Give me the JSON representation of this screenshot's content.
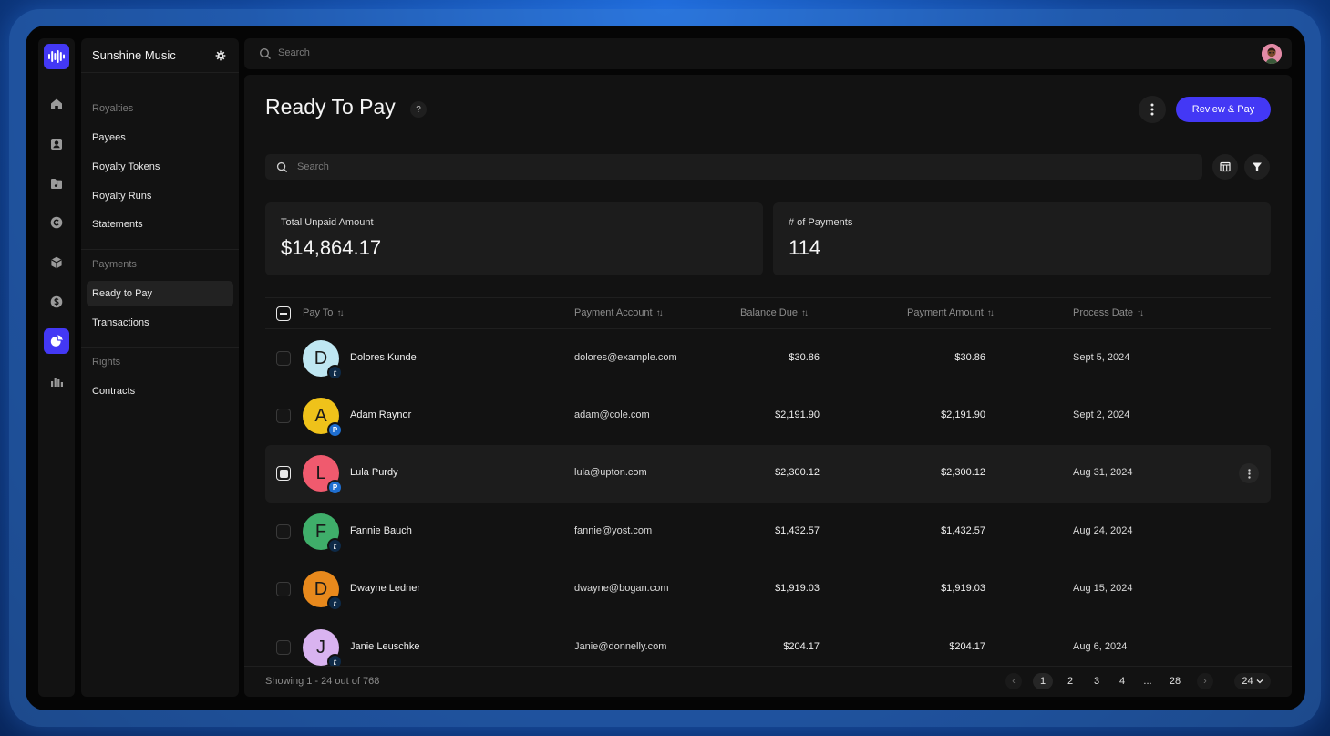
{
  "app": {
    "org_name": "Sunshine Music",
    "search_placeholder": "Search"
  },
  "sidebar": {
    "sections": [
      {
        "label": "Royalties",
        "items": [
          "Payees",
          "Royalty Tokens",
          "Royalty Runs",
          "Statements"
        ]
      },
      {
        "label": "Payments",
        "items": [
          "Ready to Pay",
          "Transactions"
        ]
      },
      {
        "label": "Rights",
        "items": [
          "Contracts"
        ]
      }
    ],
    "active_item": "Ready to Pay"
  },
  "rail": {
    "icons": [
      "home-icon",
      "contacts-icon",
      "music-folder-icon",
      "copyright-icon",
      "box-icon",
      "dollar-icon",
      "payments-icon",
      "analytics-icon"
    ],
    "active_icon": "payments-icon"
  },
  "page": {
    "title": "Ready To Pay",
    "help": "?",
    "primary_action": "Review & Pay",
    "search_placeholder": "Search"
  },
  "stats": [
    {
      "label": "Total Unpaid Amount",
      "value": "$14,864.17"
    },
    {
      "label": "# of Payments",
      "value": "114"
    }
  ],
  "table": {
    "columns": [
      "Pay To",
      "Payment Account",
      "Balance Due",
      "Payment Amount",
      "Process Date"
    ],
    "rows": [
      {
        "initial": "D",
        "avatar_color": "#bfe7f2",
        "method": "tipalti",
        "name": "Dolores Kunde",
        "account": "dolores@example.com",
        "balance": "$30.86",
        "amount": "$30.86",
        "date": "Sept 5, 2024",
        "checked": false
      },
      {
        "initial": "A",
        "avatar_color": "#efc21a",
        "method": "paypal",
        "name": "Adam Raynor",
        "account": "adam@cole.com",
        "balance": "$2,191.90",
        "amount": "$2,191.90",
        "date": "Sept 2, 2024",
        "checked": false
      },
      {
        "initial": "L",
        "avatar_color": "#f05a6e",
        "method": "paypal",
        "name": "Lula Purdy",
        "account": "lula@upton.com",
        "balance": "$2,300.12",
        "amount": "$2,300.12",
        "date": "Aug 31, 2024",
        "checked": true
      },
      {
        "initial": "F",
        "avatar_color": "#3fae6a",
        "method": "tipalti",
        "name": "Fannie Bauch",
        "account": "fannie@yost.com",
        "balance": "$1,432.57",
        "amount": "$1,432.57",
        "date": "Aug 24, 2024",
        "checked": false
      },
      {
        "initial": "D",
        "avatar_color": "#e8891c",
        "method": "tipalti",
        "name": "Dwayne Ledner",
        "account": "dwayne@bogan.com",
        "balance": "$1,919.03",
        "amount": "$1,919.03",
        "date": "Aug 15, 2024",
        "checked": false
      },
      {
        "initial": "J",
        "avatar_color": "#d9b3f0",
        "method": "tipalti",
        "name": "Janie Leuschke",
        "account": "Janie@donnelly.com",
        "balance": "$204.17",
        "amount": "$204.17",
        "date": "Aug 6, 2024",
        "checked": false
      }
    ]
  },
  "footer": {
    "showing": "Showing 1 - 24 out of 768",
    "pages": [
      "1",
      "2",
      "3",
      "4",
      "...",
      "28"
    ],
    "current_page": "1",
    "per_page": "24"
  },
  "colors": {
    "accent": "#4338f5",
    "background": "#050505",
    "panel": "#121212",
    "card": "#1c1c1c",
    "tipalti": "#0e2a47",
    "paypal": "#1f6fd1"
  }
}
